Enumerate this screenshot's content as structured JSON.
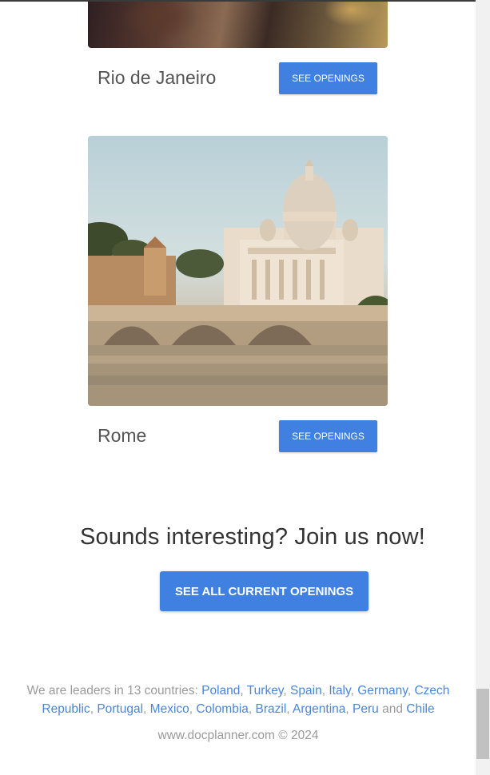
{
  "locations": [
    {
      "city": "Rio de Janeiro",
      "button_label": "SEE OPENINGS"
    },
    {
      "city": "Rome",
      "button_label": "SEE OPENINGS"
    }
  ],
  "cta": {
    "title": "Sounds interesting? Join us now!",
    "button_label": "SEE ALL CURRENT OPENINGS"
  },
  "footer": {
    "countries_intro": "We are leaders in 13 countries:",
    "countries": [
      "Poland",
      "Turkey",
      "Spain",
      "Italy",
      "Germany",
      "Czech Republic",
      "Portugal",
      "Mexico",
      "Colombia",
      "Brazil",
      "Argentina",
      "Peru",
      "Chile"
    ],
    "and_word": "and",
    "copyright": "www.docplanner.com © 2024"
  },
  "colors": {
    "button_blue": "#3f80e0",
    "link_blue": "#4a86d8",
    "muted_text": "#9a9a9a"
  }
}
